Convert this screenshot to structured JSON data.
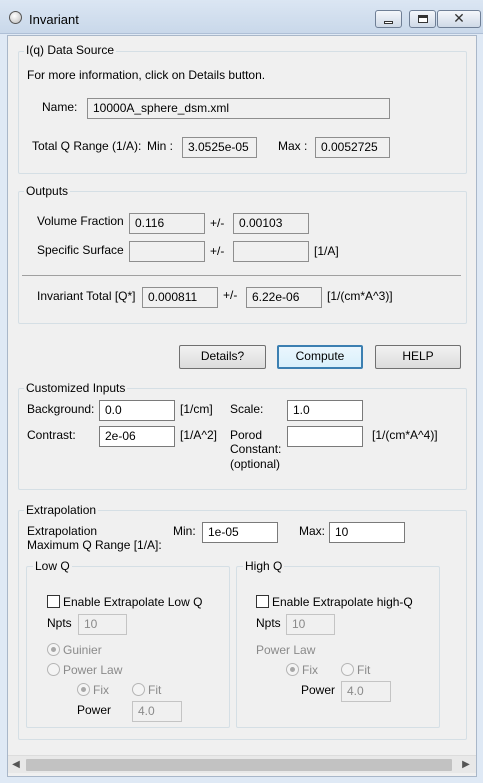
{
  "window": {
    "title": "Invariant"
  },
  "source": {
    "title": "I(q) Data Source",
    "info": "For more information, click on Details button.",
    "name_label": "Name:",
    "name_value": "10000A_sphere_dsm.xml",
    "qrange_label": "Total Q Range (1/A):",
    "min_label": "Min :",
    "min_value": "3.0525e-05",
    "max_label": "Max :",
    "max_value": "0.0052725"
  },
  "outputs": {
    "title": "Outputs",
    "volume_label": "Volume Fraction",
    "volume_value": "0.116",
    "pm1": "+/-",
    "volume_err": "0.00103",
    "surface_label": "Specific Surface",
    "surface_value": "",
    "pm2": "+/-",
    "surface_err": "",
    "surface_unit": "[1/A]",
    "invariant_label": "Invariant Total [Q*]",
    "invariant_value": "0.000811",
    "pm3": "+/-",
    "invariant_err": "6.22e-06",
    "invariant_unit": "[1/(cm*A^3)]"
  },
  "buttons": {
    "details": "Details?",
    "compute": "Compute",
    "help": "HELP"
  },
  "custom": {
    "title": "Customized Inputs",
    "background_label": "Background:",
    "background_value": "0.0",
    "background_unit": "[1/cm]",
    "scale_label": "Scale:",
    "scale_value": "1.0",
    "contrast_label": "Contrast:",
    "contrast_value": "2e-06",
    "contrast_unit": "[1/A^2]",
    "porod_label_1": "Porod",
    "porod_label_2": "Constant:",
    "porod_label_3": "(optional)",
    "porod_value": "",
    "porod_unit": "[1/(cm*A^4)]"
  },
  "extrap": {
    "title": "Extrapolation",
    "range_label_1": "Extrapolation",
    "range_label_2": "Maximum Q Range [1/A]:",
    "min_label": "Min:",
    "min_value": "1e-05",
    "max_label": "Max:",
    "max_value": "10",
    "low": {
      "title": "Low Q",
      "enable_label": "Enable Extrapolate Low Q",
      "npts_label": "Npts",
      "npts_value": "10",
      "guinier_label": "Guinier",
      "powerlaw_label": "Power Law",
      "fix_label": "Fix",
      "fit_label": "Fit",
      "power_label": "Power",
      "power_value": "4.0"
    },
    "high": {
      "title": "High Q",
      "enable_label": "Enable Extrapolate high-Q",
      "npts_label": "Npts",
      "npts_value": "10",
      "powerlaw_label": "Power Law",
      "fix_label": "Fix",
      "fit_label": "Fit",
      "power_label": "Power",
      "power_value": "4.0"
    }
  }
}
